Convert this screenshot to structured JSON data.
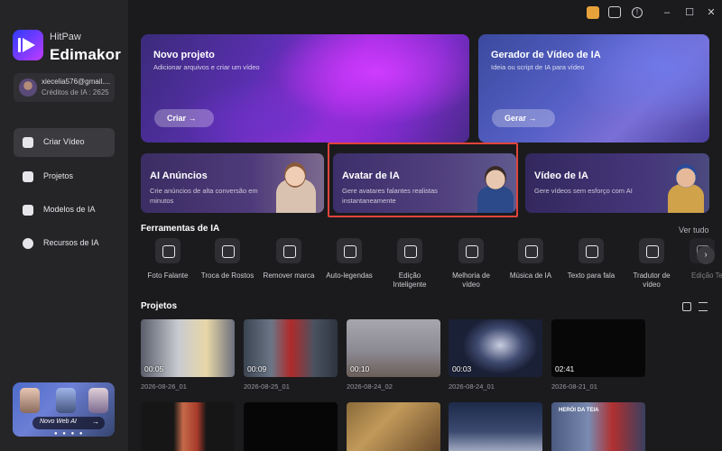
{
  "brand": {
    "line1": "HitPaw",
    "line2": "Edimakor"
  },
  "user": {
    "email": "xiecelia576@gmail....",
    "credits": "Créditos de IA : 2625"
  },
  "sidebar": {
    "items": [
      {
        "label": "Criar Vídeo",
        "icon": "create-video-icon",
        "active": true
      },
      {
        "label": "Projetos",
        "icon": "folder-icon"
      },
      {
        "label": "Modelos de IA",
        "icon": "template-icon"
      },
      {
        "label": "Recursos de IA",
        "icon": "resources-icon"
      }
    ],
    "promo": {
      "text": "Novo Web AI",
      "arrow": "→"
    }
  },
  "titlebar": {
    "icons": [
      "gift-icon",
      "message-icon",
      "help-icon",
      "minimize-icon",
      "maximize-icon",
      "close-icon"
    ],
    "minimize": "–",
    "maximize": "☐",
    "close": "✕"
  },
  "main": {
    "novo": {
      "title": "Novo projeto",
      "subtitle": "Adicionar arquivos e criar um vídeo",
      "button": "Criar →"
    },
    "gerador": {
      "title": "Gerador de Vídeo de IA",
      "subtitle": "Ideia ou script de IA para vídeo",
      "button": "Gerar →"
    },
    "cards": [
      {
        "title": "AI Anúncios",
        "subtitle": "Crie anúncios de alta conversão em minutos"
      },
      {
        "title": "Avatar de IA",
        "subtitle": "Gere avatares falantes realistas instantaneamente"
      },
      {
        "title": "Vídeo de IA",
        "subtitle": "Gere vídeos sem esforço com AI"
      }
    ],
    "tools_title": "Ferramentas de IA",
    "see_all": "Ver tudo",
    "tools": [
      {
        "label": "Foto Falante",
        "icon": "talking-photo-icon"
      },
      {
        "label": "Troca de Rostos",
        "icon": "face-swap-icon"
      },
      {
        "label": "Remover marca",
        "icon": "remove-watermark-icon"
      },
      {
        "label": "Auto-legendas",
        "icon": "subtitles-icon"
      },
      {
        "label": "Edição Inteligente",
        "icon": "smart-edit-icon"
      },
      {
        "label": "Melhoria de vídeo",
        "icon": "video-enhance-icon"
      },
      {
        "label": "Música de IA",
        "icon": "ai-music-icon"
      },
      {
        "label": "Texto para fala",
        "icon": "text-to-speech-icon"
      },
      {
        "label": "Tradutor de vídeo",
        "icon": "video-translator-icon"
      },
      {
        "label": "Edição Te",
        "icon": "text-edit-icon"
      }
    ],
    "projects_title": "Projetos",
    "projects": [
      {
        "duration": "00:05",
        "date": "2026-08-26_01"
      },
      {
        "duration": "00:09",
        "date": "2026-08-25_01"
      },
      {
        "duration": "00:10",
        "date": "2026-08-24_02"
      },
      {
        "duration": "00:03",
        "date": "2026-08-24_01"
      },
      {
        "duration": "02:41",
        "date": "2026-08-21_01"
      }
    ],
    "projects_row2_caption": "HERÓI DA TEIA"
  }
}
